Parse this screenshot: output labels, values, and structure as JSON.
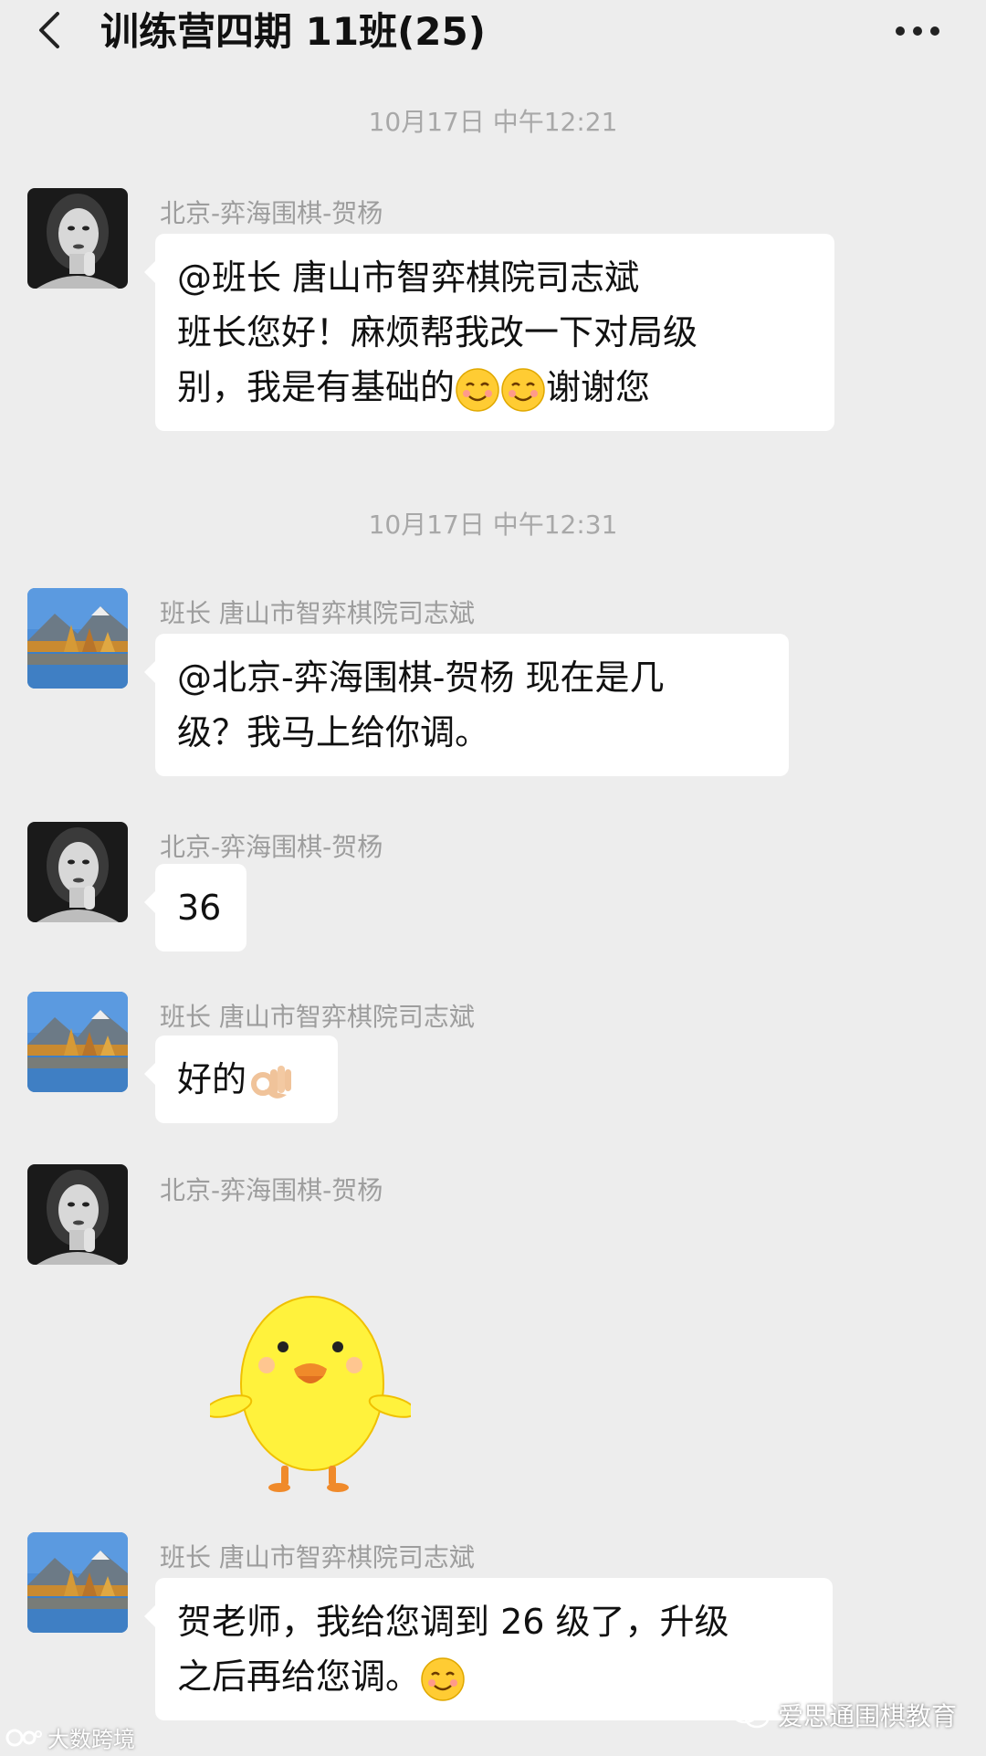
{
  "header": {
    "title": "训练营四期 11班(25)",
    "back_icon": "chevron-left-icon",
    "more_icon": "more-dots-icon"
  },
  "timestamps": [
    "10月17日 中午12:21",
    "10月17日 中午12:31"
  ],
  "messages": [
    {
      "sender": "北京-弈海围棋-贺杨",
      "avatar": "woman-portrait-avatar",
      "lines": [
        "@班长 唐山市智弈棋院司志斌",
        "班长您好！麻烦帮我改一下对局级",
        "别，我是有基础的"
      ],
      "line3_tail": "谢谢您"
    },
    {
      "sender": "班长 唐山市智弈棋院司志斌",
      "avatar": "landscape-lake-avatar",
      "lines": [
        "@北京-弈海围棋-贺杨  现在是几",
        "级？我马上给你调。"
      ]
    },
    {
      "sender": "北京-弈海围棋-贺杨",
      "avatar": "woman-portrait-avatar",
      "text": "36"
    },
    {
      "sender": "班长 唐山市智弈棋院司志斌",
      "avatar": "landscape-lake-avatar",
      "text": "好的"
    },
    {
      "sender": "北京-弈海围棋-贺杨",
      "avatar": "woman-portrait-avatar",
      "sticker": "yellow-duck-sticker"
    },
    {
      "sender": "班长 唐山市智弈棋院司志斌",
      "avatar": "landscape-lake-avatar",
      "lines": [
        "贺老师，我给您调到 26 级了，升级",
        "之后再给您调。"
      ]
    }
  ],
  "watermarks": {
    "left": "大数跨境",
    "right": "爱思通围棋教育"
  },
  "colors": {
    "background": "#ededed",
    "bubble": "#ffffff",
    "meta_text": "#9d9d9d"
  }
}
